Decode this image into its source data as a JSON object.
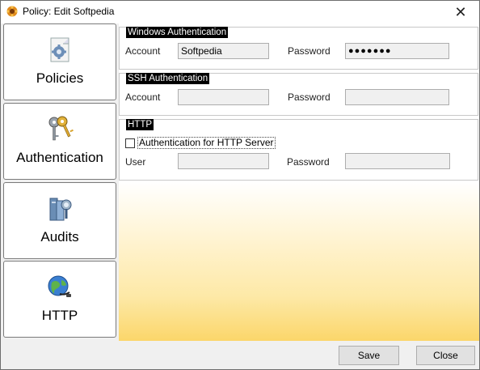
{
  "window": {
    "title": "Policy: Edit Softpedia",
    "close_glyph": "✕"
  },
  "nav": {
    "items": [
      {
        "label": "Policies",
        "icon": "gear-document-icon"
      },
      {
        "label": "Authentication",
        "icon": "keys-icon"
      },
      {
        "label": "Audits",
        "icon": "audit-books-icon"
      },
      {
        "label": "HTTP",
        "icon": "globe-icon"
      }
    ]
  },
  "windows_auth": {
    "title": "Windows Authentication",
    "account_label": "Account",
    "account_value": "Softpedia",
    "password_label": "Password",
    "password_value": "●●●●●●●"
  },
  "ssh_auth": {
    "title": "SSH Authentication",
    "account_label": "Account",
    "account_value": "",
    "password_label": "Password",
    "password_value": ""
  },
  "http": {
    "title": "HTTP",
    "checkbox_label": "Authentication for HTTP Server",
    "checkbox_checked": false,
    "user_label": "User",
    "user_value": "",
    "password_label": "Password",
    "password_value": ""
  },
  "footer": {
    "save_label": "Save",
    "close_label": "Close"
  }
}
